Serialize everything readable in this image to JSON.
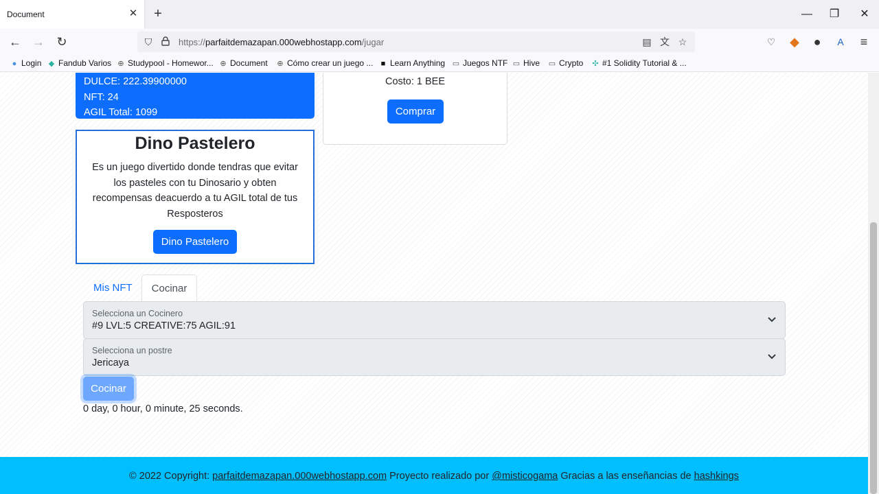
{
  "browser": {
    "tab_title": "Document",
    "url_scheme": "https://",
    "url_host": "parfaitdemazapan.000webhostapp.com",
    "url_path": "/jugar",
    "bookmarks": [
      {
        "label": "Login",
        "icon": "dot-icon"
      },
      {
        "label": "Fandub Varios",
        "icon": "app-icon"
      },
      {
        "label": "Studypool - Homewor...",
        "icon": "globe-icon"
      },
      {
        "label": "Document",
        "icon": "globe-icon"
      },
      {
        "label": "Cómo crear un juego ...",
        "icon": "globe-icon"
      },
      {
        "label": "Learn Anything",
        "icon": "map-icon"
      },
      {
        "label": "Juegos NTF",
        "icon": "folder-icon"
      },
      {
        "label": "Hive",
        "icon": "folder-icon"
      },
      {
        "label": "Crypto",
        "icon": "folder-icon"
      },
      {
        "label": "#1 Solidity Tutorial & ...",
        "icon": "link-icon"
      }
    ]
  },
  "stats": {
    "dulce": "DULCE: 222.39900000",
    "nft": "NFT: 24",
    "agil": "AGIL Total: 1099"
  },
  "shop": {
    "cost": "Costo: 1 BEE",
    "buy_label": "Comprar"
  },
  "dino": {
    "title": "Dino Pastelero",
    "description": "Es un juego divertido donde tendras que evitar los pasteles con tu Dinosario y obten recompensas deacuerdo a tu AGIL total de tus Resposteros",
    "button": "Dino Pastelero"
  },
  "tabs": {
    "mis_nft": "Mis NFT",
    "cocinar": "Cocinar"
  },
  "cook_form": {
    "chef_label": "Selecciona un Cocinero",
    "chef_value": "#9 LVL:5 CREATIVE:75 AGIL:91",
    "dessert_label": "Selecciona un postre",
    "dessert_value": "Jericaya",
    "submit": "Cocinar",
    "timer": "0 day, 0 hour, 0 minute, 25 seconds."
  },
  "footer": {
    "prefix": "© 2022 Copyright:",
    "site_link": "parfaitdemazapan.000webhostapp.com",
    "middle": "Proyecto realizado por",
    "author_link": "@misticogama",
    "thanks": "Gracias a las enseñancias de",
    "credit_link": "hashkings"
  },
  "colors": {
    "primary": "#0d6efd",
    "footer": "#00bfff",
    "disabled_button": "#6ea8fe"
  }
}
